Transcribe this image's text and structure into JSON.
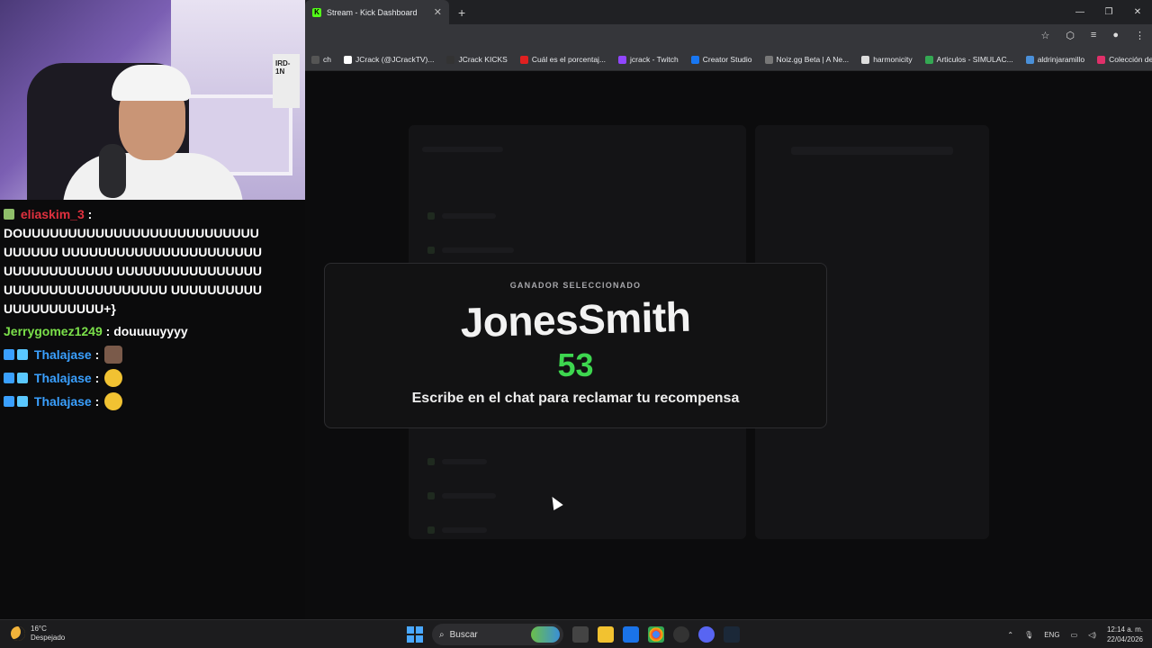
{
  "webcam": {
    "cam_label": "IRD-1N"
  },
  "chat": {
    "messages": [
      {
        "user": "eliaskim_3",
        "color": "#e0303e",
        "text": "DOUUUUUUUUUUUUUUUUUUUUUUUUUUUUUUUU UUUUUUUUUUUUUUUUUUUUUUUUUUUUUUUUUU UUUUUUUUUUUUUUUUUUUUUUUUUUUUUUUUUU UUUUUUUUUUUUUUUUUUUUU+}"
      },
      {
        "user": "Jerrygomez1249",
        "color": "#7be04a",
        "text": "douuuuyyyy"
      },
      {
        "user": "Thalajase",
        "color": "#3aa0ff",
        "text": ""
      },
      {
        "user": "Thalajase",
        "color": "#3aa0ff",
        "text": ""
      },
      {
        "user": "Thalajase",
        "color": "#3aa0ff",
        "text": ""
      }
    ],
    "separator": ":"
  },
  "browser": {
    "tab_title": "Stream - Kick Dashboard",
    "tab_favicon": "K",
    "new_tab": "+",
    "bookmarks": [
      {
        "label": "ch",
        "color": "#555"
      },
      {
        "label": "JCrack (@JCrackTV)...",
        "color": "#fff"
      },
      {
        "label": "JCrack KICKS",
        "color": "#333"
      },
      {
        "label": "Cuál es el porcentaj...",
        "color": "#e02020"
      },
      {
        "label": "jcrack - Twitch",
        "color": "#9146ff"
      },
      {
        "label": "Creator Studio",
        "color": "#1877f2"
      },
      {
        "label": "Noiz.gg Beta | A Ne...",
        "color": "#777"
      },
      {
        "label": "harmonicity",
        "color": "#ddd"
      },
      {
        "label": "Articulos - SIMULAC...",
        "color": "#34a853"
      },
      {
        "label": "aldrinjaramillo",
        "color": "#4a90d9"
      },
      {
        "label": "Colección de M_blei...",
        "color": "#e0306a"
      }
    ],
    "bookmarks_more": "»"
  },
  "modal": {
    "kicker": "GANADOR SELECCIONADO",
    "winner": "JonesSmith",
    "number": "53",
    "message": "Escribe en el chat para reclamar tu recompensa",
    "accent": "#3dd64f"
  },
  "taskbar": {
    "temperature": "16°C",
    "weather": "Despejado",
    "search_placeholder": "Buscar",
    "language": "ENG",
    "time": "12:14 a. m.",
    "date": "22/04/2026"
  }
}
